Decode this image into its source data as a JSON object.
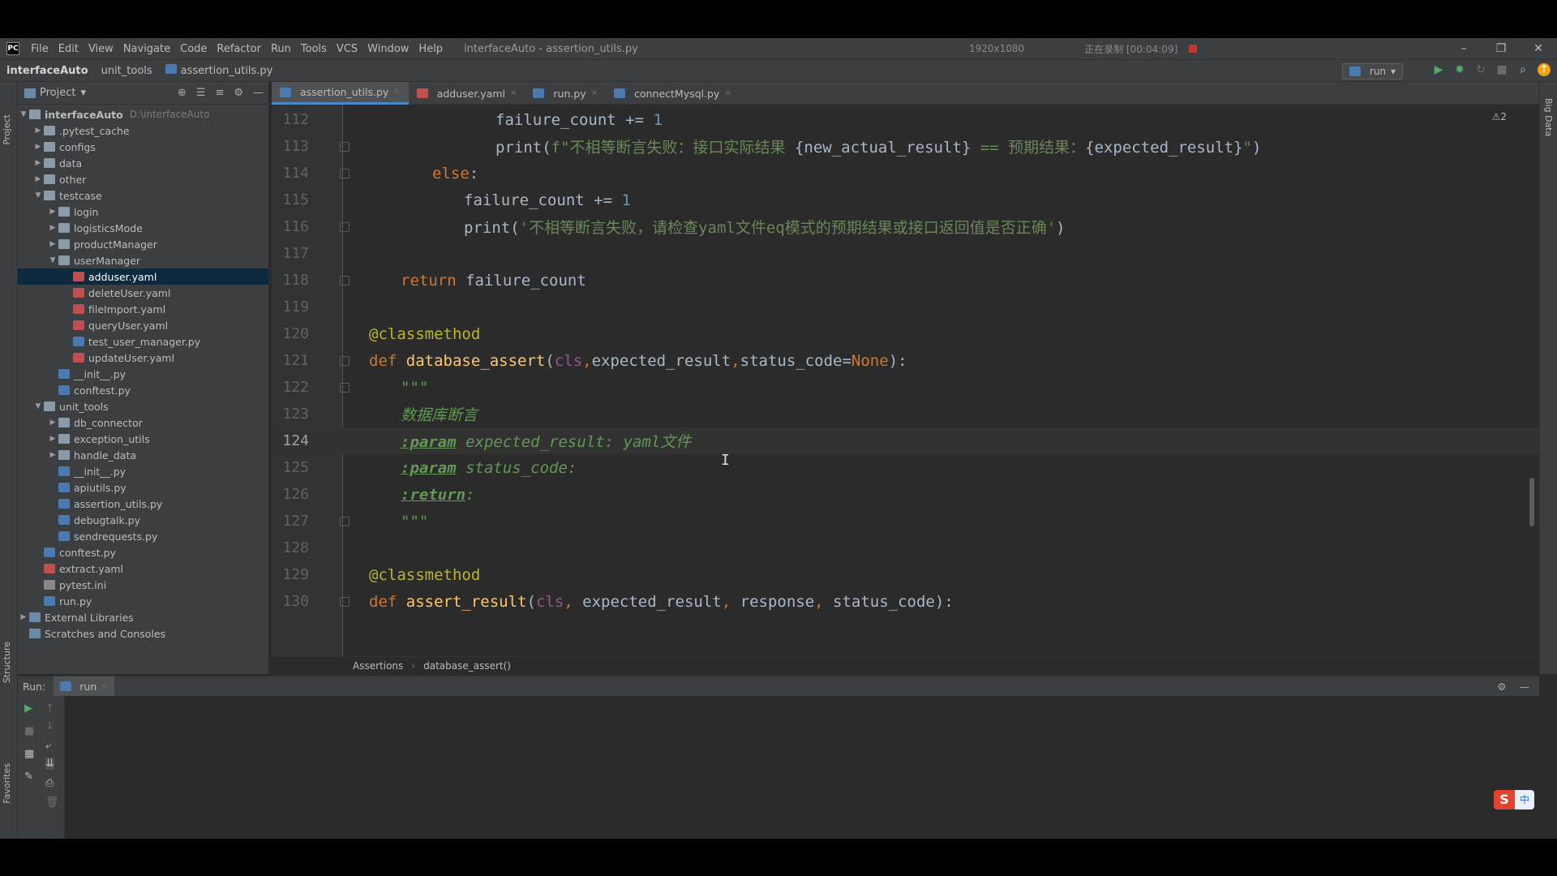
{
  "window": {
    "title": "interfaceAuto - assertion_utils.py",
    "menu": [
      "File",
      "Edit",
      "View",
      "Navigate",
      "Code",
      "Refactor",
      "Run",
      "Tools",
      "VCS",
      "Window",
      "Help"
    ],
    "recording": {
      "resolution": "1920x1080",
      "status": "正在录制 [00:04:09]"
    }
  },
  "navbar": {
    "project": "interfaceAuto",
    "folder": "unit_tools",
    "file": "assertion_utils.py",
    "run_config": "run"
  },
  "project_panel": {
    "label": "Project",
    "root": "interfaceAuto",
    "root_path": "D:\\interfaceAuto",
    "items": [
      {
        "label": ".pytest_cache",
        "type": "folder",
        "level": 1,
        "expanded": false
      },
      {
        "label": "configs",
        "type": "folder",
        "level": 1,
        "expanded": false
      },
      {
        "label": "data",
        "type": "folder",
        "level": 1,
        "expanded": false
      },
      {
        "label": "other",
        "type": "folder",
        "level": 1,
        "expanded": false
      },
      {
        "label": "testcase",
        "type": "folder",
        "level": 1,
        "expanded": true
      },
      {
        "label": "login",
        "type": "folder",
        "level": 2,
        "expanded": false
      },
      {
        "label": "logisticsMode",
        "type": "folder",
        "level": 2,
        "expanded": false
      },
      {
        "label": "productManager",
        "type": "folder",
        "level": 2,
        "expanded": false
      },
      {
        "label": "userManager",
        "type": "folder",
        "level": 2,
        "expanded": true
      },
      {
        "label": "adduser.yaml",
        "type": "yaml",
        "level": 3,
        "selected": true
      },
      {
        "label": "deleteUser.yaml",
        "type": "yaml",
        "level": 3
      },
      {
        "label": "fileImport.yaml",
        "type": "yaml",
        "level": 3
      },
      {
        "label": "queryUser.yaml",
        "type": "yaml",
        "level": 3
      },
      {
        "label": "test_user_manager.py",
        "type": "py",
        "level": 3
      },
      {
        "label": "updateUser.yaml",
        "type": "yaml",
        "level": 3
      },
      {
        "label": "__init__.py",
        "type": "py",
        "level": 2
      },
      {
        "label": "conftest.py",
        "type": "py",
        "level": 2
      },
      {
        "label": "unit_tools",
        "type": "folder",
        "level": 1,
        "expanded": true
      },
      {
        "label": "db_connector",
        "type": "folder",
        "level": 2,
        "expanded": false
      },
      {
        "label": "exception_utils",
        "type": "folder",
        "level": 2,
        "expanded": false
      },
      {
        "label": "handle_data",
        "type": "folder",
        "level": 2,
        "expanded": false
      },
      {
        "label": "__init__.py",
        "type": "py",
        "level": 2
      },
      {
        "label": "apiutils.py",
        "type": "py",
        "level": 2
      },
      {
        "label": "assertion_utils.py",
        "type": "py",
        "level": 2
      },
      {
        "label": "debugtalk.py",
        "type": "py",
        "level": 2
      },
      {
        "label": "sendrequests.py",
        "type": "py",
        "level": 2
      },
      {
        "label": "conftest.py",
        "type": "py",
        "level": 1
      },
      {
        "label": "extract.yaml",
        "type": "yaml",
        "level": 1
      },
      {
        "label": "pytest.ini",
        "type": "ini",
        "level": 1
      },
      {
        "label": "run.py",
        "type": "py",
        "level": 1
      },
      {
        "label": "External Libraries",
        "type": "lib",
        "level": 0,
        "expanded": false
      },
      {
        "label": "Scratches and Consoles",
        "type": "lib",
        "level": 0
      }
    ]
  },
  "tabs": [
    {
      "label": "assertion_utils.py",
      "active": true
    },
    {
      "label": "adduser.yaml",
      "active": false
    },
    {
      "label": "run.py",
      "active": false
    },
    {
      "label": "connectMysql.py",
      "active": false
    }
  ],
  "editor": {
    "warnings": "⚠2",
    "current_line": 124,
    "lines": [
      {
        "n": 112,
        "indent": 4,
        "tokens": [
          [
            "",
            "failure_count += "
          ],
          [
            "num",
            "1"
          ]
        ]
      },
      {
        "n": 113,
        "indent": 4,
        "tokens": [
          [
            "",
            "print("
          ],
          [
            "str",
            "f\"不相等断言失败：接口实际结果 "
          ],
          [
            "",
            "{new_actual_result}"
          ],
          [
            "str",
            " == 预期结果："
          ],
          [
            "",
            "{expected_result}"
          ],
          [
            "str",
            "\""
          ],
          [
            "",
            ")"
          ]
        ]
      },
      {
        "n": 114,
        "indent": 2,
        "tokens": [
          [
            "kw",
            "else"
          ],
          [
            "",
            ":"
          ]
        ]
      },
      {
        "n": 115,
        "indent": 3,
        "tokens": [
          [
            "",
            "failure_count += "
          ],
          [
            "num",
            "1"
          ]
        ]
      },
      {
        "n": 116,
        "indent": 3,
        "tokens": [
          [
            "",
            "print("
          ],
          [
            "str",
            "'不相等断言失败，请检查yaml文件eq模式的预期结果或接口返回值是否正确'"
          ],
          [
            "",
            ")"
          ]
        ]
      },
      {
        "n": 117,
        "indent": 0,
        "tokens": []
      },
      {
        "n": 118,
        "indent": 1,
        "tokens": [
          [
            "kw",
            "return"
          ],
          [
            "",
            " failure_count"
          ]
        ]
      },
      {
        "n": 119,
        "indent": 0,
        "tokens": []
      },
      {
        "n": 120,
        "indent": 0,
        "tokens": [
          [
            "dec",
            "@classmethod"
          ]
        ]
      },
      {
        "n": 121,
        "indent": 0,
        "tokens": [
          [
            "kw",
            "def "
          ],
          [
            "fn",
            "database_assert"
          ],
          [
            "",
            "("
          ],
          [
            "cls",
            "cls"
          ],
          [
            "kw",
            ","
          ],
          [
            "",
            "expected_result"
          ],
          [
            "kw",
            ","
          ],
          [
            "",
            "status_code="
          ],
          [
            "kw",
            "None"
          ],
          [
            "",
            "):"
          ]
        ]
      },
      {
        "n": 122,
        "indent": 1,
        "tokens": [
          [
            "doc",
            "\"\"\""
          ]
        ]
      },
      {
        "n": 123,
        "indent": 1,
        "tokens": [
          [
            "doc",
            "数据库断言"
          ]
        ]
      },
      {
        "n": 124,
        "indent": 1,
        "tokens": [
          [
            "doctag",
            ":param"
          ],
          [
            "doc",
            " expected_result: yaml文件"
          ]
        ]
      },
      {
        "n": 125,
        "indent": 1,
        "tokens": [
          [
            "doctag",
            ":param"
          ],
          [
            "doc",
            " status_code:"
          ]
        ]
      },
      {
        "n": 126,
        "indent": 1,
        "tokens": [
          [
            "doctag",
            ":return"
          ],
          [
            "doc",
            ":"
          ]
        ]
      },
      {
        "n": 127,
        "indent": 1,
        "tokens": [
          [
            "doc",
            "\"\"\""
          ]
        ]
      },
      {
        "n": 128,
        "indent": 0,
        "tokens": []
      },
      {
        "n": 129,
        "indent": 0,
        "tokens": [
          [
            "dec",
            "@classmethod"
          ]
        ]
      },
      {
        "n": 130,
        "indent": 0,
        "tokens": [
          [
            "kw",
            "def "
          ],
          [
            "fn",
            "assert_result"
          ],
          [
            "",
            "("
          ],
          [
            "cls",
            "cls"
          ],
          [
            "kw",
            ", "
          ],
          [
            "",
            "expected_result"
          ],
          [
            "kw",
            ", "
          ],
          [
            "",
            "response"
          ],
          [
            "kw",
            ", "
          ],
          [
            "",
            "status_code"
          ],
          [
            "",
            "):"
          ]
        ]
      }
    ],
    "breadcrumbs": [
      "Assertions",
      "database_assert()"
    ]
  },
  "run_panel": {
    "label": "Run:",
    "tab": "run"
  },
  "side_tabs": {
    "project": "Project",
    "structure": "Structure",
    "favorites": "Favorites",
    "bigdata": "Big Data"
  },
  "ime": {
    "logo": "S",
    "mode": "中"
  }
}
